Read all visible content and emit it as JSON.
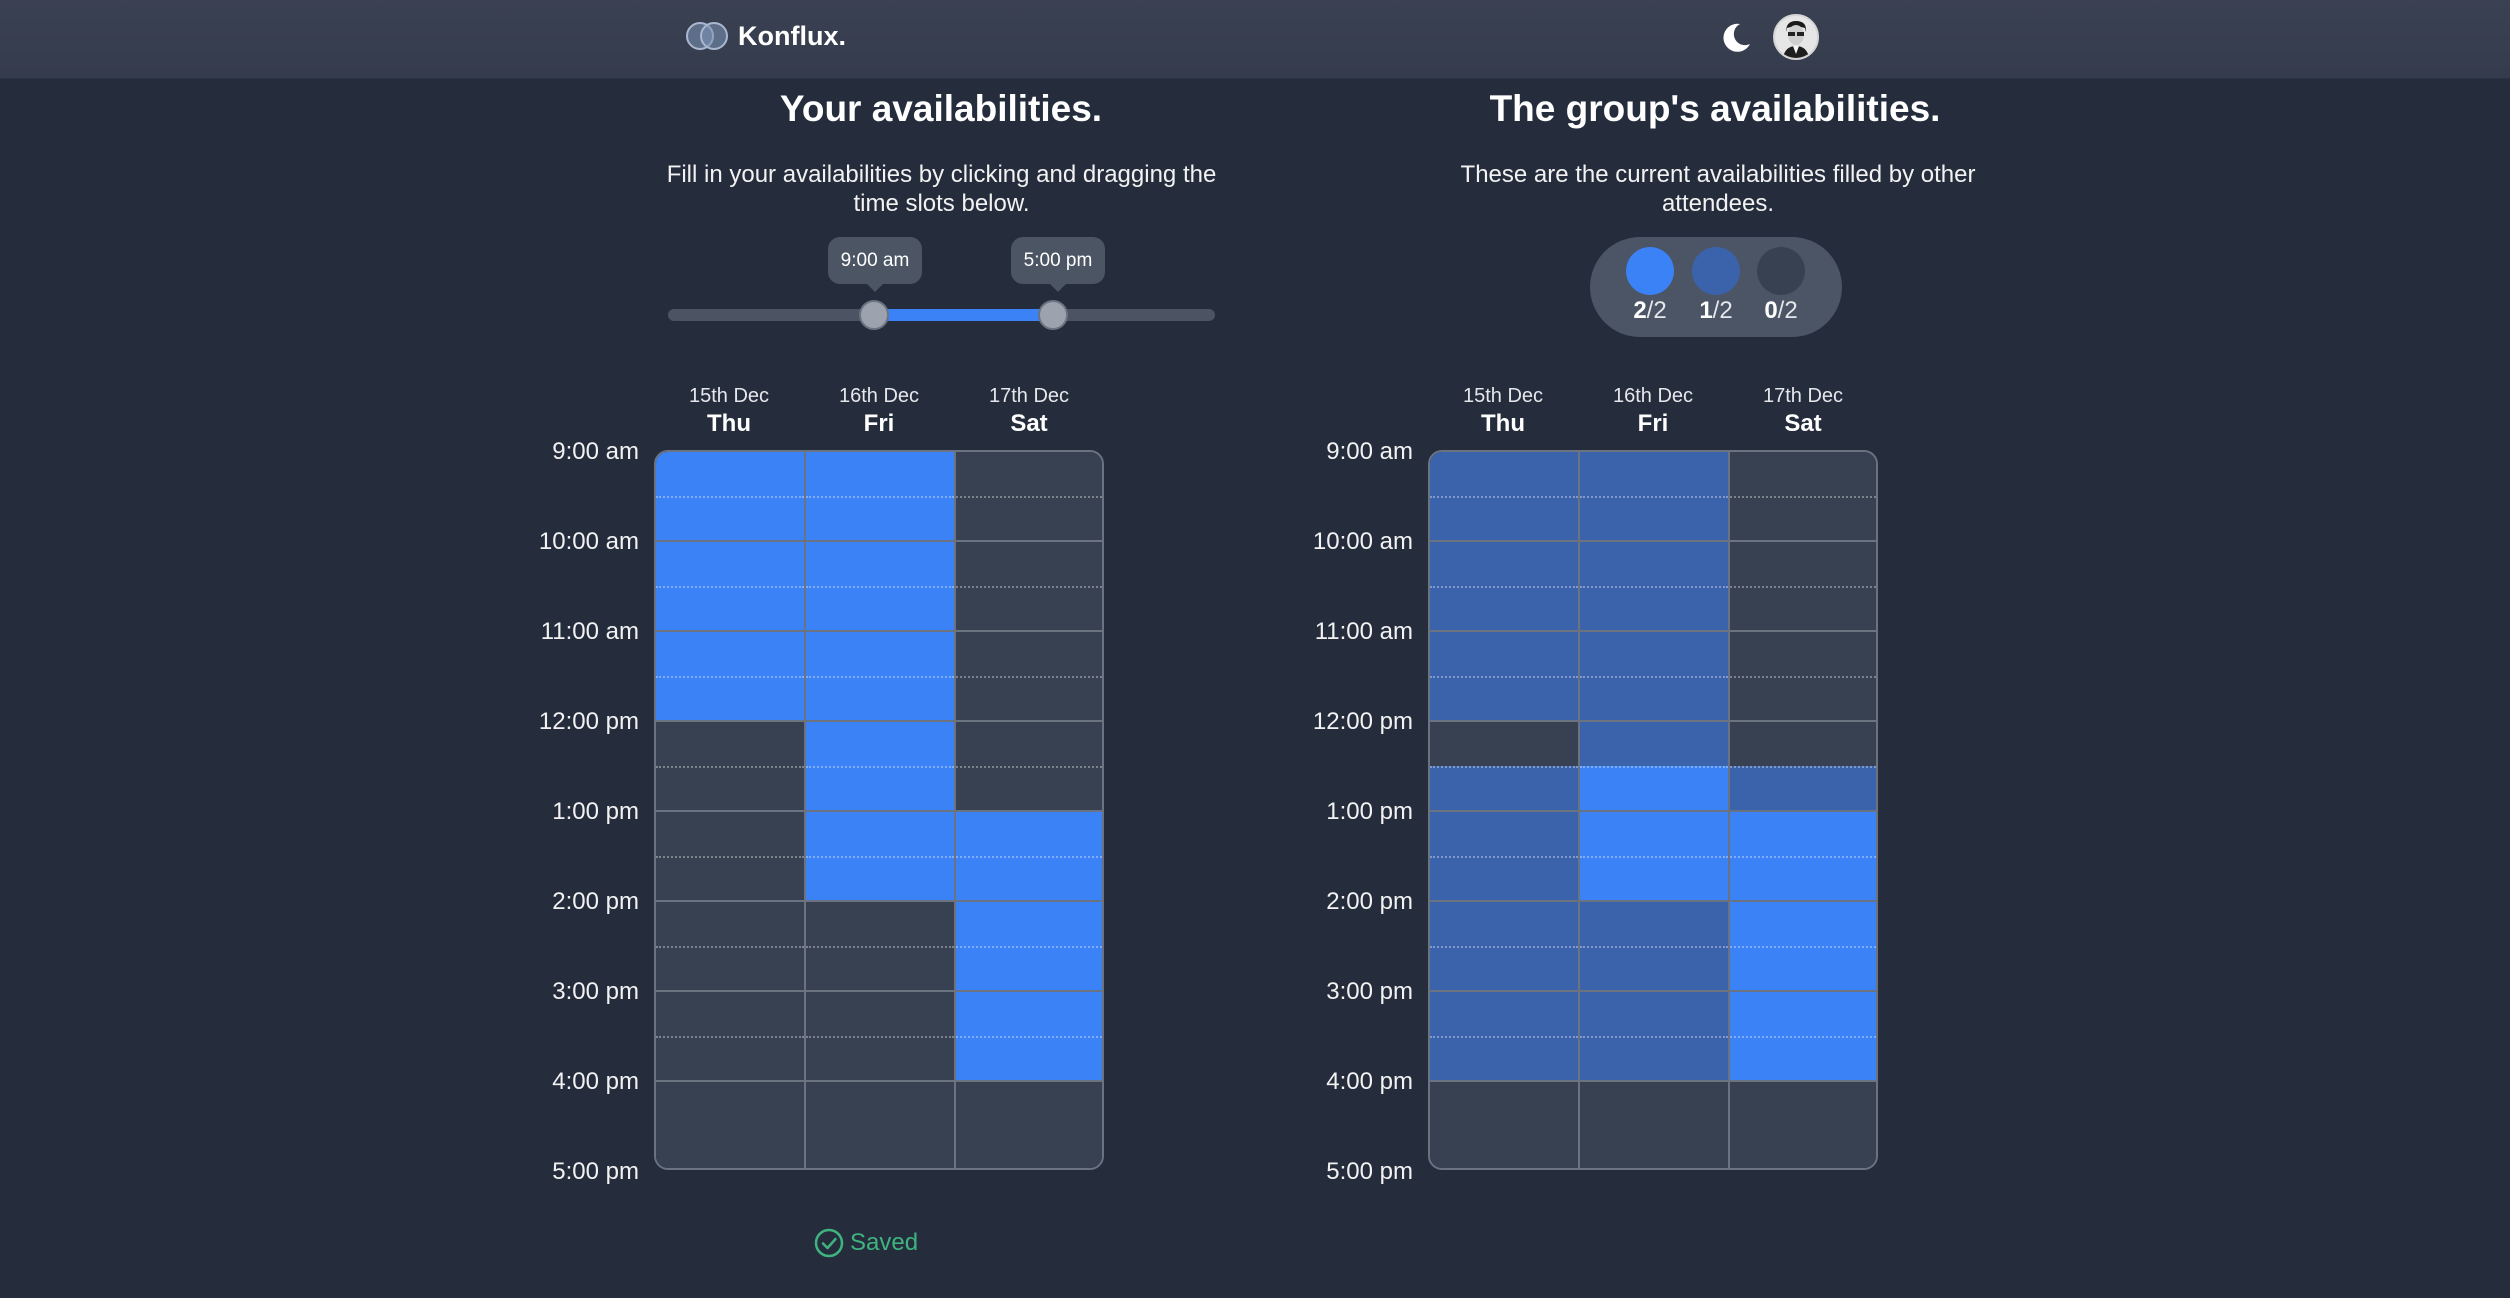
{
  "header": {
    "brand": "Konflux."
  },
  "left": {
    "title": "Your availabilities.",
    "description": "Fill in your availabilities by clicking and dragging the time slots below.",
    "slider_start_label": "9:00 am",
    "slider_end_label": "5:00 pm",
    "saved_label": "Saved"
  },
  "right": {
    "title": "The group's availabilities.",
    "description": "These are the current availabilities filled by other attendees.",
    "legend": [
      {
        "count": "2",
        "total": "/2",
        "color": "#3b82f6"
      },
      {
        "count": "1",
        "total": "/2",
        "color": "#3b63ab"
      },
      {
        "count": "0",
        "total": "/2",
        "color": "#374151"
      }
    ]
  },
  "days": [
    {
      "date": "15th Dec",
      "weekday": "Thu"
    },
    {
      "date": "16th Dec",
      "weekday": "Fri"
    },
    {
      "date": "17th Dec",
      "weekday": "Sat"
    }
  ],
  "times": [
    "9:00 am",
    "10:00 am",
    "11:00 am",
    "12:00 pm",
    "1:00 pm",
    "2:00 pm",
    "3:00 pm",
    "4:00 pm",
    "5:00 pm"
  ],
  "colors": {
    "full": "#3b82f6",
    "partial": "#3b63ab",
    "empty": "#374151"
  },
  "my_availability": [
    [
      1,
      1,
      1,
      1,
      1,
      1,
      0,
      0,
      0,
      0,
      0,
      0,
      0,
      0,
      0,
      0
    ],
    [
      1,
      1,
      1,
      1,
      1,
      1,
      1,
      1,
      1,
      1,
      0,
      0,
      0,
      0,
      0,
      0
    ],
    [
      0,
      0,
      0,
      0,
      0,
      0,
      0,
      0,
      1,
      1,
      1,
      1,
      1,
      1,
      0,
      0
    ]
  ],
  "group_availability": [
    [
      1,
      1,
      1,
      1,
      1,
      1,
      0,
      1,
      1,
      1,
      1,
      1,
      1,
      1,
      0,
      0
    ],
    [
      1,
      1,
      1,
      1,
      1,
      1,
      1,
      2,
      2,
      2,
      1,
      1,
      1,
      1,
      0,
      0
    ],
    [
      0,
      0,
      0,
      0,
      0,
      0,
      0,
      1,
      2,
      2,
      2,
      2,
      2,
      2,
      0,
      0
    ]
  ]
}
